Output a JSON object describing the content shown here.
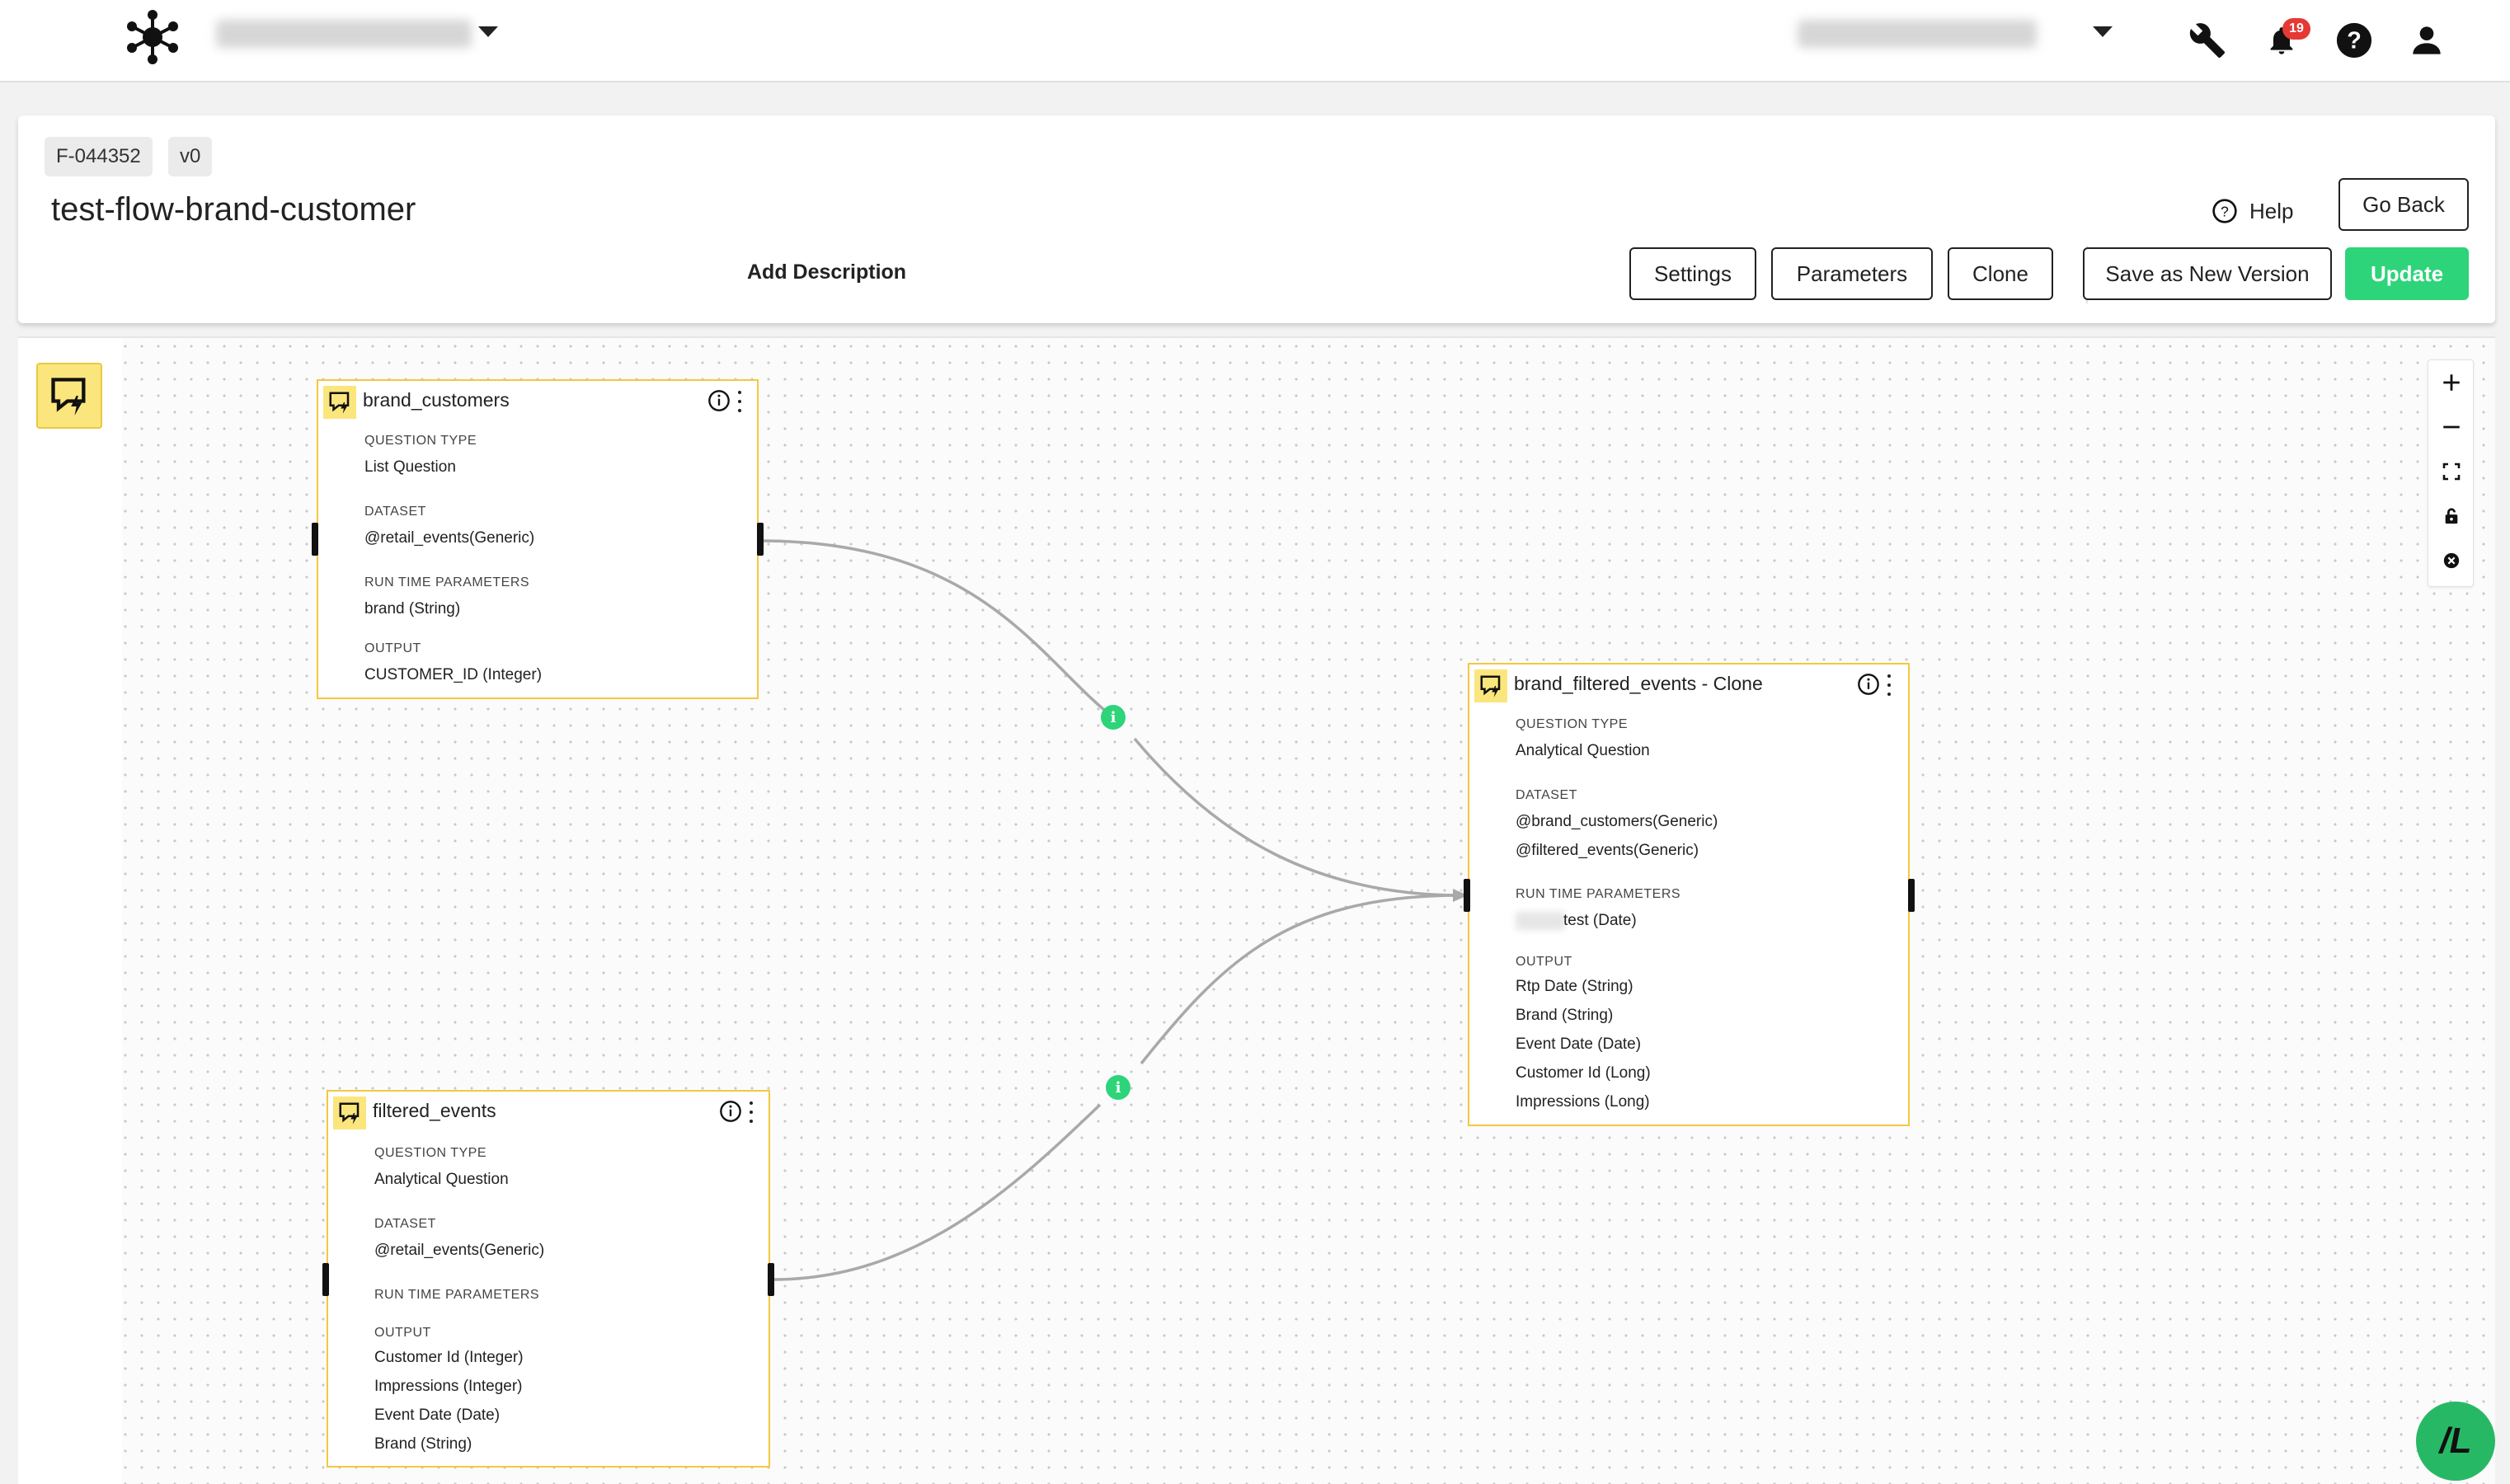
{
  "topbar": {
    "logo_icon": "network-hub-icon",
    "notification_count": "19",
    "icons": [
      "wrench-icon",
      "bell-icon",
      "help-circle-icon",
      "user-icon"
    ]
  },
  "header": {
    "flow_id": "F-044352",
    "version": "v0",
    "title": "test-flow-brand-customer",
    "add_description_label": "Add Description",
    "help_label": "Help",
    "go_back_label": "Go Back",
    "settings_label": "Settings",
    "parameters_label": "Parameters",
    "clone_label": "Clone",
    "save_new_version_label": "Save as New Version",
    "update_label": "Update"
  },
  "nodes": {
    "brand_customers": {
      "title": "brand_customers",
      "question_type_label": "QUESTION TYPE",
      "question_type": "List Question",
      "dataset_label": "DATASET",
      "dataset": [
        "@retail_events(Generic)"
      ],
      "params_label": "RUN TIME PARAMETERS",
      "params": [
        "brand (String)"
      ],
      "output_label": "OUTPUT",
      "output": [
        "CUSTOMER_ID (Integer)"
      ]
    },
    "filtered_events": {
      "title": "filtered_events",
      "question_type_label": "QUESTION TYPE",
      "question_type": "Analytical Question",
      "dataset_label": "DATASET",
      "dataset": [
        "@retail_events(Generic)"
      ],
      "params_label": "RUN TIME PARAMETERS",
      "params": [],
      "output_label": "OUTPUT",
      "output": [
        "Customer Id (Integer)",
        "Impressions (Integer)",
        "Event Date (Date)",
        "Brand (String)"
      ]
    },
    "brand_filtered_events_clone": {
      "title": "brand_filtered_events - Clone",
      "question_type_label": "QUESTION TYPE",
      "question_type": "Analytical Question",
      "dataset_label": "DATASET",
      "dataset": [
        "@brand_customers(Generic)",
        "@filtered_events(Generic)"
      ],
      "params_label": "RUN TIME PARAMETERS",
      "params": [
        "test (Date)"
      ],
      "output_label": "OUTPUT",
      "output": [
        "Rtp Date (String)",
        "Brand (String)",
        "Event Date (Date)",
        "Customer Id (Long)",
        "Impressions (Long)"
      ]
    }
  },
  "edges": {
    "info_glyph": "i"
  },
  "fab_label": "/L",
  "colors": {
    "accent_green": "#2ed47a",
    "node_border": "#f3c83d",
    "node_icon_bg": "#fbe67d",
    "badge_red": "#e53935"
  }
}
